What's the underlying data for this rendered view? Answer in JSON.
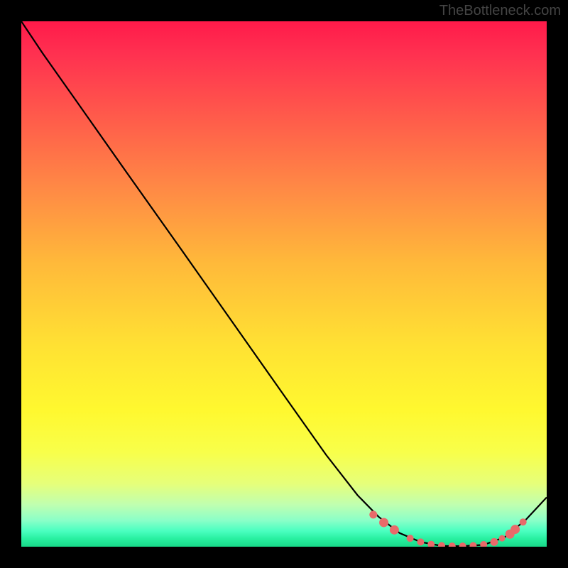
{
  "attribution": "TheBottleneck.com",
  "chart_data": {
    "type": "line",
    "title": "",
    "xlabel": "",
    "ylabel": "",
    "xlim": [
      0,
      100
    ],
    "ylim": [
      0,
      100
    ],
    "series": [
      {
        "name": "curve",
        "x": [
          0,
          4,
          10,
          20,
          30,
          40,
          50,
          58,
          64,
          68,
          72,
          76,
          80,
          84,
          88,
          92,
          96,
          100
        ],
        "y": [
          100,
          94,
          85.5,
          71.3,
          57.2,
          43.0,
          28.8,
          17.5,
          9.8,
          5.7,
          2.6,
          0.9,
          0.15,
          0.1,
          0.35,
          1.8,
          5.1,
          9.4
        ]
      }
    ],
    "markers": {
      "name": "dots",
      "points": [
        {
          "x": 67,
          "y": 6.1,
          "r": 5.5
        },
        {
          "x": 69,
          "y": 4.6,
          "r": 6.5
        },
        {
          "x": 71,
          "y": 3.2,
          "r": 6.5
        },
        {
          "x": 74,
          "y": 1.6,
          "r": 5
        },
        {
          "x": 76,
          "y": 0.9,
          "r": 5
        },
        {
          "x": 78,
          "y": 0.45,
          "r": 5
        },
        {
          "x": 80,
          "y": 0.2,
          "r": 5
        },
        {
          "x": 82,
          "y": 0.12,
          "r": 5
        },
        {
          "x": 84,
          "y": 0.12,
          "r": 5
        },
        {
          "x": 86,
          "y": 0.2,
          "r": 5
        },
        {
          "x": 88,
          "y": 0.4,
          "r": 5
        },
        {
          "x": 90,
          "y": 0.9,
          "r": 5.5
        },
        {
          "x": 91.5,
          "y": 1.6,
          "r": 4.5
        },
        {
          "x": 93,
          "y": 2.4,
          "r": 6.5
        },
        {
          "x": 94,
          "y": 3.3,
          "r": 6.5
        },
        {
          "x": 95.5,
          "y": 4.7,
          "r": 5
        }
      ]
    },
    "background": {
      "type": "vertical-gradient",
      "stops": [
        {
          "pos": 0,
          "color": "#ff1a4a"
        },
        {
          "pos": 50,
          "color": "#ffc838"
        },
        {
          "pos": 80,
          "color": "#fcff33"
        },
        {
          "pos": 100,
          "color": "#18d888"
        }
      ]
    }
  }
}
